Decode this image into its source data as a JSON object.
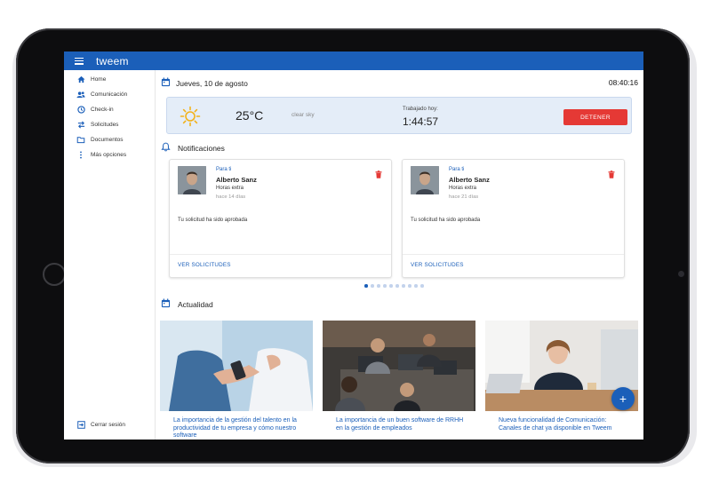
{
  "app": {
    "brand": "tweem"
  },
  "colors": {
    "primary": "#1b5fb9",
    "danger": "#e53935",
    "weather_bg": "#e4edf8"
  },
  "sidebar": {
    "items": [
      {
        "label": "Home",
        "icon": "home-icon"
      },
      {
        "label": "Comunicación",
        "icon": "people-icon"
      },
      {
        "label": "Check-in",
        "icon": "clock-icon"
      },
      {
        "label": "Solicitudes",
        "icon": "swap-icon"
      },
      {
        "label": "Documentos",
        "icon": "folder-icon"
      },
      {
        "label": "Más opciones",
        "icon": "more-icon"
      }
    ],
    "logout": {
      "label": "Cerrar sesión",
      "icon": "logout-icon"
    }
  },
  "header": {
    "date": "Jueves, 10 de agosto",
    "time": "08:40:16"
  },
  "weather": {
    "temperature": "25°C",
    "condition": "clear sky",
    "worked_label": "Trabajado hoy:",
    "worked_time": "1:44:57",
    "stop_label": "DETENER"
  },
  "notifications": {
    "title": "Notificaciones",
    "items": [
      {
        "for": "Para ti",
        "name": "Alberto Sanz",
        "type": "Horas extra",
        "ago": "hace 14 días",
        "message": "Tu solicitud ha sido aprobada",
        "link": "VER SOLICITUDES"
      },
      {
        "for": "Para ti",
        "name": "Alberto Sanz",
        "type": "Horas extra",
        "ago": "hace 21 días",
        "message": "Tu solicitud ha sido aprobada",
        "link": "VER SOLICITUDES"
      }
    ],
    "pagination": {
      "total": 10,
      "active": 0
    }
  },
  "news": {
    "title": "Actualidad",
    "items": [
      {
        "title": "La importancia de la gestión del talento en la productividad de tu empresa y cómo nuestro software"
      },
      {
        "title": "La importancia de un buen software de RRHH en la gestión de empleados"
      },
      {
        "title": "Nueva funcionalidad de Comunicación: Canales de chat ya disponible en Tweem"
      }
    ]
  },
  "fab": {
    "label": "+"
  }
}
